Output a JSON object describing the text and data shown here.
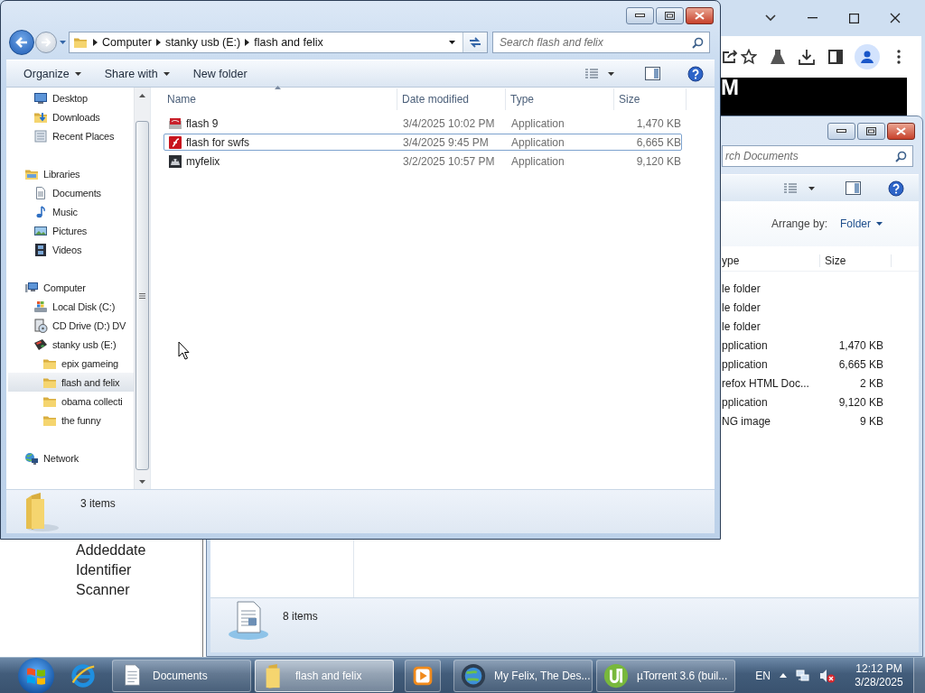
{
  "browser": {
    "banner_text": "M",
    "fields": [
      "Addeddate",
      "Identifier",
      "Scanner"
    ]
  },
  "documents_window": {
    "search": {
      "placeholder": "rch Documents"
    },
    "arrange_by": {
      "label": "Arrange by:",
      "value": "Folder"
    },
    "columns": [
      "ype",
      "Size"
    ],
    "rows": [
      {
        "type": "le folder"
      },
      {
        "type": "le folder"
      },
      {
        "type": "le folder"
      },
      {
        "type": "pplication",
        "size": "1,470 KB"
      },
      {
        "type": "pplication",
        "size": "6,665 KB"
      },
      {
        "type": "refox HTML Doc...",
        "size": "2 KB"
      },
      {
        "type": "pplication",
        "size": "9,120 KB"
      },
      {
        "type": "NG image",
        "size": "9 KB"
      }
    ],
    "status": "8 items"
  },
  "explorer": {
    "breadcrumb": [
      "Computer",
      "stanky usb (E:)",
      "flash and felix"
    ],
    "search": {
      "placeholder": "Search flash and felix"
    },
    "toolbar": [
      {
        "label": "Organize",
        "dropdown": true
      },
      {
        "label": "Share with",
        "dropdown": true
      },
      {
        "label": "New folder",
        "dropdown": false
      }
    ],
    "nav": [
      {
        "children": [
          {
            "label": "Desktop",
            "kind": "desktop",
            "selected": false
          },
          {
            "label": "Downloads",
            "kind": "download",
            "selected": false
          },
          {
            "label": "Recent Places",
            "kind": "recent",
            "selected": false
          }
        ]
      },
      {
        "label": "Libraries",
        "kind": "library",
        "selected": false,
        "children": [
          {
            "label": "Documents",
            "kind": "document",
            "selected": false
          },
          {
            "label": "Music",
            "kind": "music",
            "selected": false
          },
          {
            "label": "Pictures",
            "kind": "picture",
            "selected": false
          },
          {
            "label": "Videos",
            "kind": "video",
            "selected": false
          }
        ]
      },
      {
        "label": "Computer",
        "kind": "computer",
        "selected": false,
        "children": [
          {
            "label": "Local Disk (C:)",
            "kind": "disk",
            "selected": false
          },
          {
            "label": "CD Drive (D:) DV",
            "kind": "cd",
            "selected": false
          },
          {
            "label": "stanky usb (E:)",
            "kind": "usb",
            "selected": false,
            "children": [
              {
                "label": "epix gameing",
                "kind": "folder",
                "selected": false
              },
              {
                "label": "flash and felix",
                "kind": "folder",
                "selected": true
              },
              {
                "label": "obama collecti",
                "kind": "folder",
                "selected": false
              },
              {
                "label": "the funny",
                "kind": "folder",
                "selected": false
              }
            ]
          }
        ]
      },
      {
        "label": "Network",
        "kind": "network",
        "selected": false
      }
    ],
    "columns": [
      "Name",
      "Date modified",
      "Type",
      "Size"
    ],
    "files": [
      {
        "name": "flash 9",
        "kind": "installer",
        "date": "3/4/2025 10:02 PM",
        "type": "Application",
        "size": "1,470 KB",
        "selected": false
      },
      {
        "name": "flash for swfs",
        "kind": "flash",
        "date": "3/4/2025 9:45 PM",
        "type": "Application",
        "size": "6,665 KB",
        "selected": true
      },
      {
        "name": "myfelix",
        "kind": "app",
        "date": "3/2/2025 10:57 PM",
        "type": "Application",
        "size": "9,120 KB",
        "selected": false
      }
    ],
    "status": "3 items"
  },
  "taskbar": {
    "buttons": [
      {
        "kind": "ie",
        "active": false
      },
      {
        "kind": "documents",
        "label": "Documents",
        "active": false
      },
      {
        "kind": "folder",
        "label": "flash and felix",
        "active": true
      },
      {
        "kind": "media",
        "active": false
      },
      {
        "kind": "browser",
        "label": "My Felix, The Des...",
        "active": false
      },
      {
        "kind": "torrent",
        "label": "µTorrent 3.6  (buil...",
        "active": false
      }
    ],
    "language": "EN",
    "time": "12:12 PM",
    "date": "3/28/2025"
  }
}
